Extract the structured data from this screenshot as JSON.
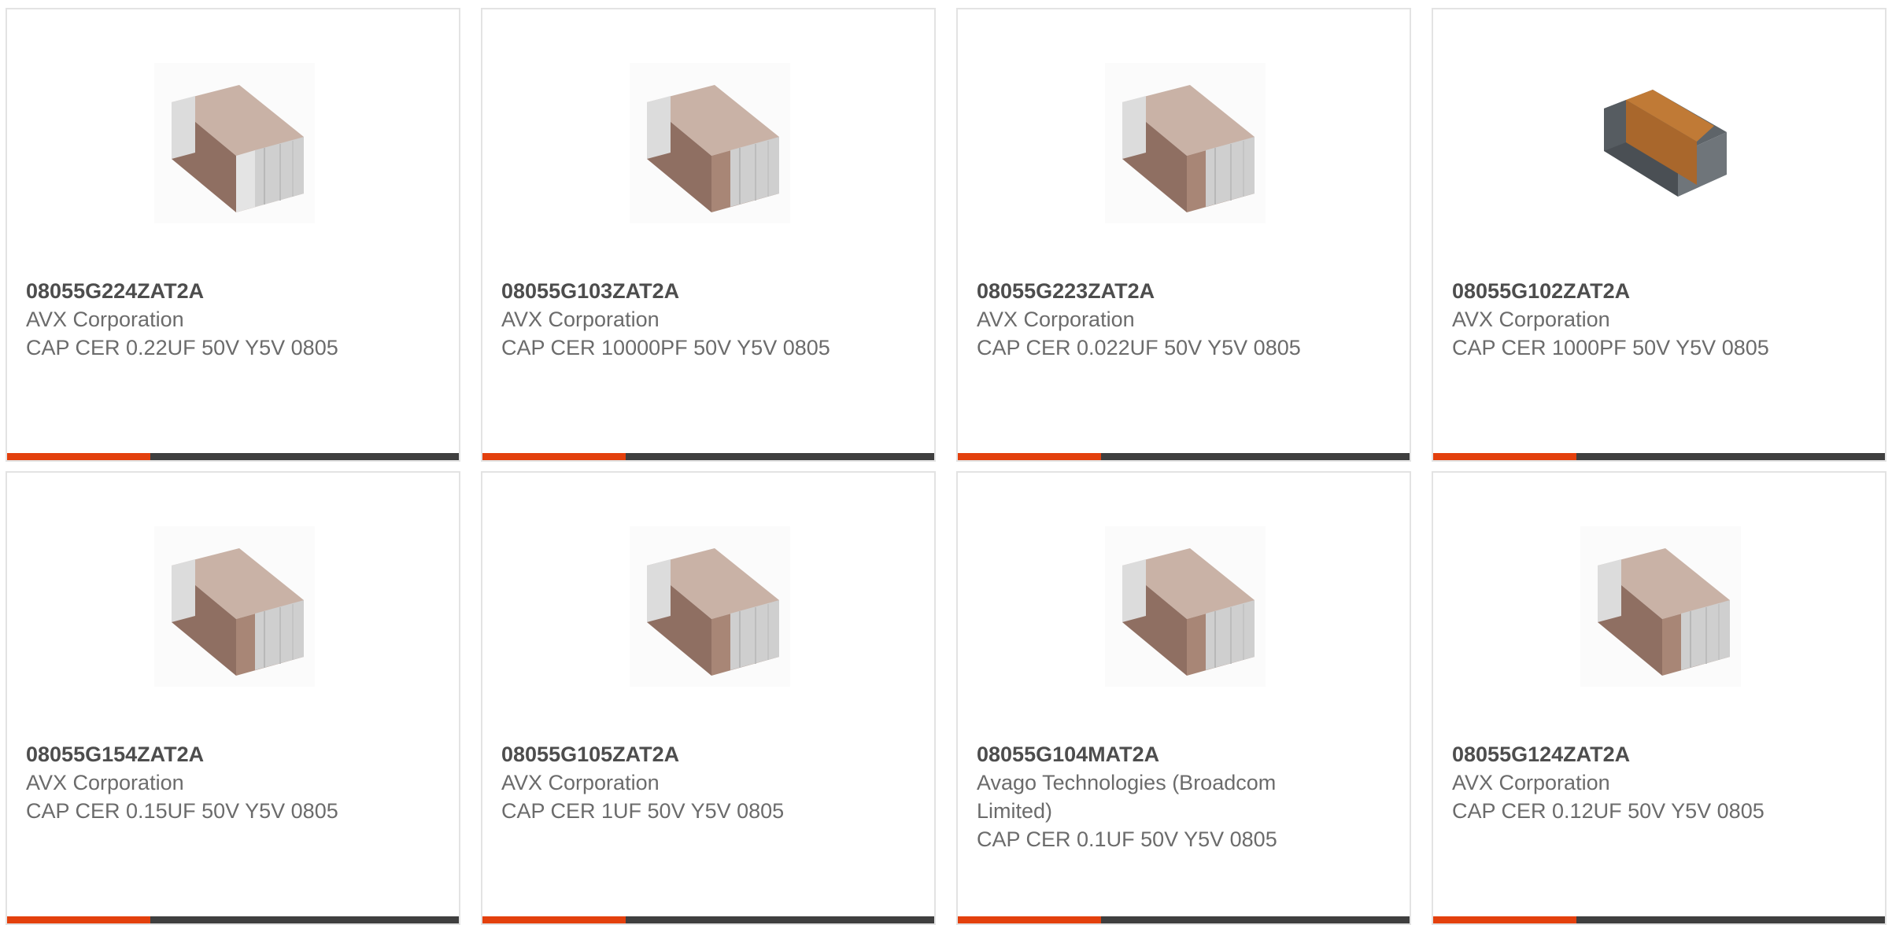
{
  "colors": {
    "accent": "#e3400d",
    "bar": "#3f3f3f",
    "border": "#e3e3e3"
  },
  "products": [
    {
      "part_number": "08055G224ZAT2A",
      "manufacturer": "AVX Corporation",
      "description": "CAP CER 0.22UF 50V Y5V 0805",
      "icon": "ceramic-capacitor-icon"
    },
    {
      "part_number": "08055G103ZAT2A",
      "manufacturer": "AVX Corporation",
      "description": "CAP CER 10000PF 50V Y5V 0805",
      "icon": "ceramic-capacitor-icon"
    },
    {
      "part_number": "08055G223ZAT2A",
      "manufacturer": "AVX Corporation",
      "description": "CAP CER 0.022UF 50V Y5V 0805",
      "icon": "ceramic-capacitor-icon"
    },
    {
      "part_number": "08055G102ZAT2A",
      "manufacturer": "AVX Corporation",
      "description": "CAP CER 1000PF 50V Y5V 0805",
      "icon": "chip-capacitor-dark-icon"
    },
    {
      "part_number": "08055G154ZAT2A",
      "manufacturer": "AVX Corporation",
      "description": "CAP CER 0.15UF 50V Y5V 0805",
      "icon": "ceramic-capacitor-icon"
    },
    {
      "part_number": "08055G105ZAT2A",
      "manufacturer": "AVX Corporation",
      "description": "CAP CER 1UF 50V Y5V 0805",
      "icon": "ceramic-capacitor-icon"
    },
    {
      "part_number": "08055G104MAT2A",
      "manufacturer": "Avago Technologies (Broadcom Limited)",
      "description": "CAP CER 0.1UF 50V Y5V 0805",
      "icon": "ceramic-capacitor-icon"
    },
    {
      "part_number": "08055G124ZAT2A",
      "manufacturer": "AVX Corporation",
      "description": "CAP CER 0.12UF 50V Y5V 0805",
      "icon": "ceramic-capacitor-icon"
    }
  ]
}
